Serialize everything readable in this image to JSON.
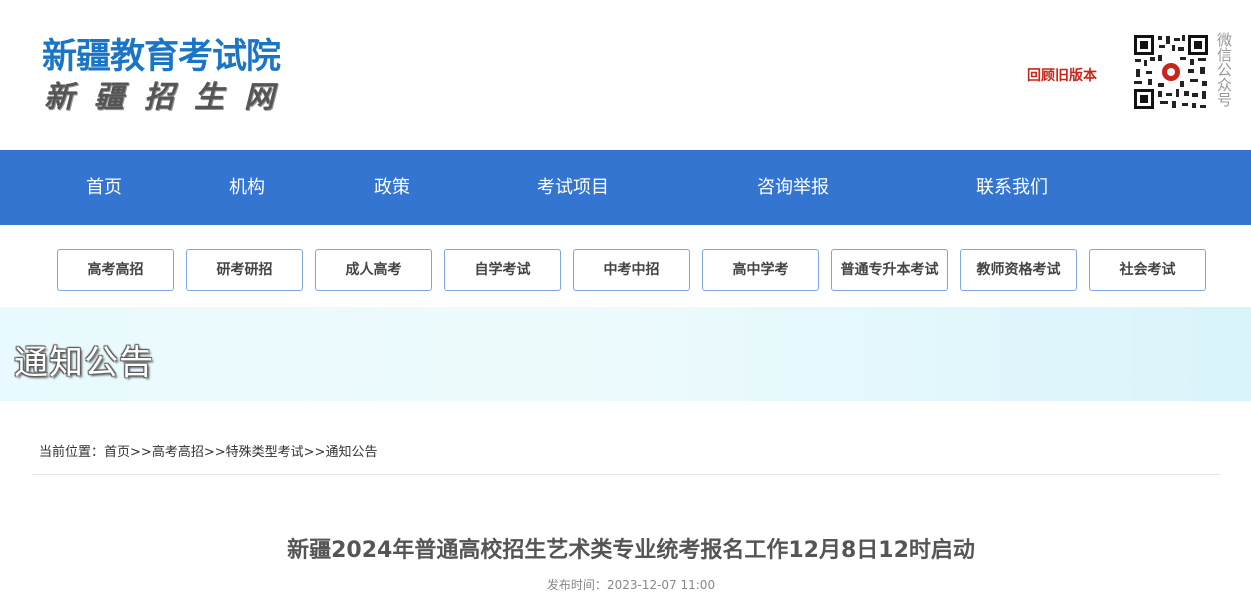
{
  "header": {
    "logo_title": "新疆教育考试院",
    "logo_subtitle": "新疆招生网",
    "old_version_link": "回顾旧版本",
    "qr_caption": "微信公众号",
    "qr_icon": "qr-code-icon"
  },
  "nav": {
    "items": [
      {
        "label": "首页"
      },
      {
        "label": "机构"
      },
      {
        "label": "政策"
      },
      {
        "label": "考试项目"
      },
      {
        "label": "咨询举报"
      },
      {
        "label": "联系我们"
      }
    ]
  },
  "subnav": {
    "items": [
      {
        "label": "高考高招"
      },
      {
        "label": "研考研招"
      },
      {
        "label": "成人高考"
      },
      {
        "label": "自学考试"
      },
      {
        "label": "中考中招"
      },
      {
        "label": "高中学考"
      },
      {
        "label": "普通专升本考试"
      },
      {
        "label": "教师资格考试"
      },
      {
        "label": "社会考试"
      }
    ]
  },
  "banner": {
    "title": "通知公告"
  },
  "breadcrumb": {
    "prefix": "当前位置：",
    "items": [
      "首页",
      "高考高招",
      "特殊类型考试",
      "通知公告"
    ],
    "separator": ">>"
  },
  "article": {
    "title": "新疆2024年普通高校招生艺术类专业统考报名工作12月8日12时启动",
    "date_label": "发布时间：",
    "date": "2023-12-07 11:00"
  },
  "colors": {
    "nav_bg": "#3375d1",
    "logo_blue": "#1b75c6",
    "old_version_red": "#c8261c",
    "subnav_border": "#7ea6e0"
  }
}
